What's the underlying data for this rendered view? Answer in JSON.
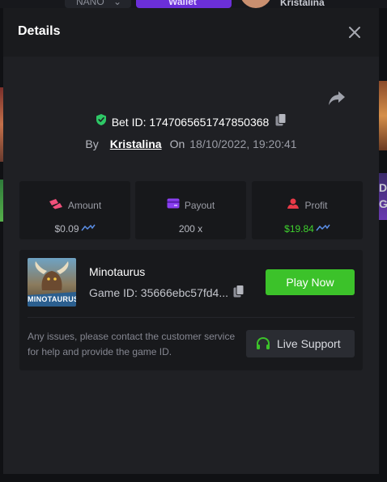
{
  "background": {
    "currency_label": "NANO",
    "wallet_label": "Wallet",
    "username": "Kristalina",
    "right_edge_letters": [
      "D",
      "G"
    ]
  },
  "modal": {
    "title": "Details",
    "bet_id_label": "Bet ID:",
    "bet_id": "1747065651747850368",
    "by_label": "By",
    "username": "Kristalina",
    "on_label": "On",
    "date": "18/10/2022, 19:20:41",
    "stats": [
      {
        "label": "Amount",
        "value": "$0.09",
        "icon": "coins-icon",
        "trend": true
      },
      {
        "label": "Payout",
        "value": "200 x",
        "icon": "card-icon",
        "trend": false
      },
      {
        "label": "Profit",
        "value": "$19.84",
        "icon": "profit-icon",
        "trend": true
      }
    ],
    "game": {
      "name": "Minotaurus",
      "id_label": "Game ID:",
      "id": "35666ebc57fd4...",
      "thumbnail_text": "MINOTAURUS",
      "play_label": "Play Now"
    },
    "issues_text": "Any issues, please contact the customer service for help and provide the game ID.",
    "support_label": "Live Support"
  },
  "colors": {
    "modal_bg": "#1f2024",
    "header_bg": "#1a1b1e",
    "card_bg": "#17181b",
    "accent_green": "#3cc22a",
    "profit_green": "#3fd12e",
    "shield_green": "#2ec866",
    "amount_pink": "#f0507a",
    "payout_purple": "#8a3ff0",
    "profit_red": "#e83a48",
    "trend_blue": "#5b8fe8"
  }
}
